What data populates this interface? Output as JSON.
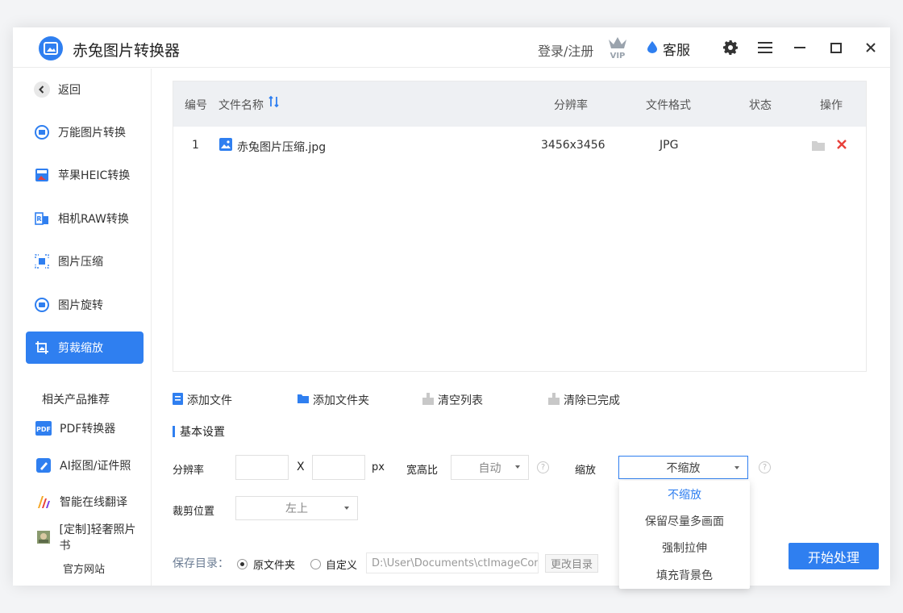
{
  "app": {
    "title": "赤兔图片转换器"
  },
  "titlebar": {
    "login_label": "登录/注册",
    "vip_label": "VIP",
    "service_label": "客服"
  },
  "sidebar": {
    "back_label": "返回",
    "items": [
      {
        "label": "万能图片转换",
        "icon": "image-convert-icon"
      },
      {
        "label": "苹果HEIC转换",
        "icon": "heic-icon"
      },
      {
        "label": "相机RAW转换",
        "icon": "raw-icon"
      },
      {
        "label": "图片压缩",
        "icon": "compress-icon"
      },
      {
        "label": "图片旋转",
        "icon": "rotate-icon"
      },
      {
        "label": "剪裁缩放",
        "icon": "crop-icon",
        "active": true
      }
    ],
    "related_heading": "相关产品推荐",
    "related": [
      {
        "label": "PDF转换器",
        "icon": "pdf-icon",
        "badge": "PDF"
      },
      {
        "label": "AI抠图/证件照",
        "icon": "ai-cutout-icon"
      },
      {
        "label": "智能在线翻译",
        "icon": "translate-icon"
      },
      {
        "label": "[定制]轻奢照片书",
        "icon": "photobook-icon"
      }
    ],
    "official_site": "官方网站"
  },
  "table": {
    "headers": {
      "index": "编号",
      "name": "文件名称",
      "resolution": "分辨率",
      "format": "文件格式",
      "status": "状态",
      "actions": "操作"
    },
    "rows": [
      {
        "index": "1",
        "name": "赤兔图片压缩.jpg",
        "resolution": "3456x3456",
        "format": "JPG",
        "status": ""
      }
    ]
  },
  "toolbar": {
    "add_file": "添加文件",
    "add_folder": "添加文件夹",
    "clear_list": "清空列表",
    "clear_done": "清除已完成"
  },
  "settings": {
    "section_title": "基本设置",
    "resolution_label": "分辨率",
    "resolution_width": "",
    "resolution_x": "X",
    "resolution_height": "",
    "resolution_unit": "px",
    "aspect_label": "宽高比",
    "aspect_value": "自动",
    "scale_label": "缩放",
    "scale_value": "不缩放",
    "scale_options": [
      "不缩放",
      "保留尽量多画面",
      "强制拉伸",
      "填充背景色"
    ],
    "crop_label": "裁剪位置",
    "crop_value": "左上",
    "help_glyph": "?"
  },
  "save": {
    "label": "保存目录：",
    "option_original": "原文件夹",
    "option_custom": "自定义",
    "path": "D:\\User\\Documents\\ctImageCon",
    "change_button": "更改目录"
  },
  "start_button": "开始处理",
  "colors": {
    "accent": "#2f7ff0",
    "danger": "#e8403a"
  }
}
